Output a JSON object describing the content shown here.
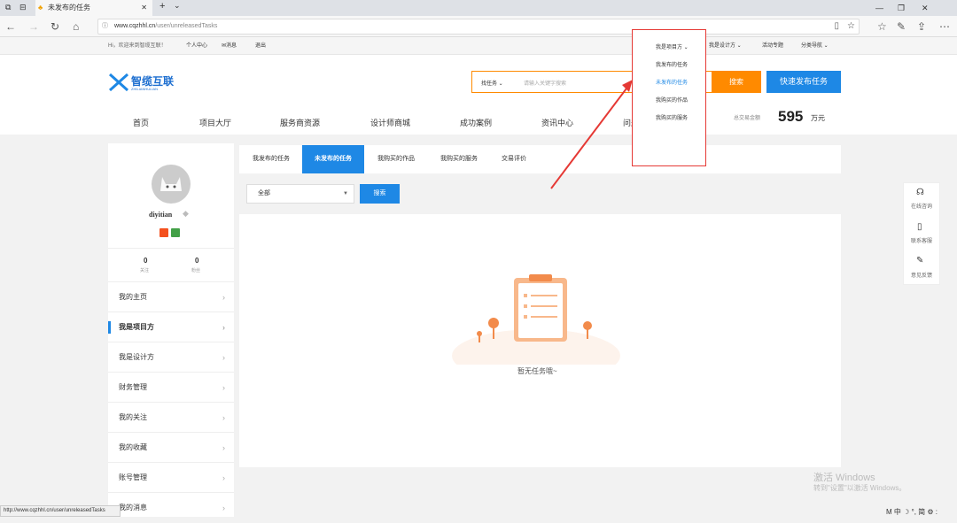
{
  "browser": {
    "tab_title": "未发布的任务",
    "url_host": "www.cqzhhl.cn",
    "url_path": "/user/unreleasedTasks",
    "status_url": "http://www.cqzhhl.cn/user/unreleasedTasks"
  },
  "topbar": {
    "greeting": "Hi，欢迎来到智缆互联！",
    "user_center": "个人中心",
    "messages": "消息",
    "logout": "退出",
    "menus": [
      "我是项目方",
      "我是设计方",
      "活动专题",
      "分类导航"
    ]
  },
  "header": {
    "logo_name": "智缆互联",
    "logo_sub": "ZHILIANHULIAN",
    "search_type": "找任务",
    "search_placeholder": "请输入关键字搜索",
    "search_btn": "搜索",
    "publish_btn": "快速发布任务",
    "nav": [
      "首页",
      "项目大厅",
      "服务商资源",
      "设计师商城",
      "成功案例",
      "资讯中心",
      "问题中心"
    ],
    "total_label": "总交易金额",
    "total_value": "595",
    "total_unit": "万元"
  },
  "dropdown": {
    "items": [
      "我发布的任务",
      "未发布的任务",
      "我购买的作品",
      "我购买的服务"
    ],
    "active_color": "#1e88e5"
  },
  "profile": {
    "username": "diyitian",
    "follow_count": "0",
    "follow_label": "关注",
    "fans_count": "0",
    "fans_label": "粉丝"
  },
  "sidebar_menu": [
    "我的主页",
    "我是项目方",
    "我是设计方",
    "财务管理",
    "我的关注",
    "我的收藏",
    "账号管理",
    "我的消息"
  ],
  "tabs": [
    "我发布的任务",
    "未发布的任务",
    "我购买的作品",
    "我购买的服务",
    "交易评价"
  ],
  "filter": {
    "value": "全部",
    "search_btn": "搜索"
  },
  "empty_text": "暂无任务哦~",
  "float_bar": [
    "在线咨询",
    "联系客服",
    "意见反馈"
  ],
  "watermark": {
    "line1": "激活 Windows",
    "line2": "转到\"设置\"以激活 Windows。"
  },
  "colors": {
    "orange": "#ff8a00",
    "blue": "#1e88e5",
    "red": "#e53935"
  }
}
